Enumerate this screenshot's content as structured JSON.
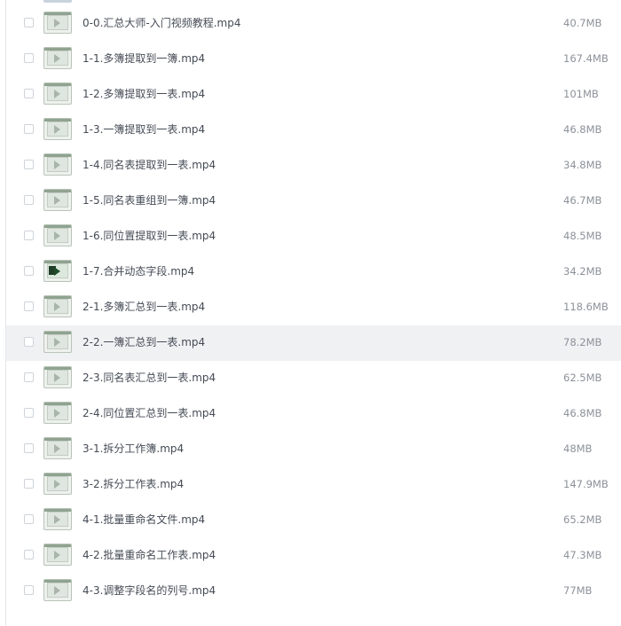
{
  "files": [
    {
      "name": "0-0.汇总大师-入门视频教程.mp4",
      "size": "40.7MB",
      "thumb": "video-thumbnail"
    },
    {
      "name": "1-1.多簿提取到一簿.mp4",
      "size": "167.4MB",
      "thumb": "video-thumbnail"
    },
    {
      "name": "1-2.多簿提取到一表.mp4",
      "size": "101MB",
      "thumb": "video-thumbnail"
    },
    {
      "name": "1-3.一簿提取到一表.mp4",
      "size": "46.8MB",
      "thumb": "video-thumbnail"
    },
    {
      "name": "1-4.同名表提取到一表.mp4",
      "size": "34.8MB",
      "thumb": "video-thumbnail"
    },
    {
      "name": "1-5.同名表重组到一簿.mp4",
      "size": "46.7MB",
      "thumb": "video-thumbnail"
    },
    {
      "name": "1-6.同位置提取到一表.mp4",
      "size": "48.5MB",
      "thumb": "video-thumbnail"
    },
    {
      "name": "1-7.合并动态字段.mp4",
      "size": "34.2MB",
      "thumb": "video-thumbnail-dark"
    },
    {
      "name": "2-1.多簿汇总到一表.mp4",
      "size": "118.6MB",
      "thumb": "video-thumbnail"
    },
    {
      "name": "2-2.一簿汇总到一表.mp4",
      "size": "78.2MB",
      "thumb": "video-thumbnail"
    },
    {
      "name": "2-3.同名表汇总到一表.mp4",
      "size": "62.5MB",
      "thumb": "video-thumbnail"
    },
    {
      "name": "2-4.同位置汇总到一表.mp4",
      "size": "46.8MB",
      "thumb": "video-thumbnail"
    },
    {
      "name": "3-1.拆分工作簿.mp4",
      "size": "48MB",
      "thumb": "video-thumbnail"
    },
    {
      "name": "3-2.拆分工作表.mp4",
      "size": "147.9MB",
      "thumb": "video-thumbnail"
    },
    {
      "name": "4-1.批量重命名文件.mp4",
      "size": "65.2MB",
      "thumb": "video-thumbnail"
    },
    {
      "name": "4-2.批量重命名工作表.mp4",
      "size": "47.3MB",
      "thumb": "video-thumbnail"
    },
    {
      "name": "4-3.调整字段名的列号.mp4",
      "size": "77MB",
      "thumb": "video-thumbnail"
    }
  ],
  "highlighted_row": 9,
  "colors": {
    "highlight": "#f0f1f3",
    "name_text": "#454b55",
    "size_text": "#8c9199"
  }
}
